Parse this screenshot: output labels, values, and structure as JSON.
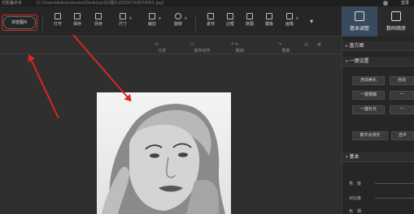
{
  "titlebar": {
    "app_title": "光影魔术手",
    "path": "[C:\\Users\\Administrator\\Desktop\\QQ图片20150730074055.jpg]",
    "login": "登录"
  },
  "toolbar": {
    "open_label": "浏览图片",
    "tools": [
      {
        "label": "打开",
        "icon": "folder-icon"
      },
      {
        "label": "保存",
        "icon": "save-icon"
      },
      {
        "label": "另存",
        "icon": "save-as-icon"
      },
      {
        "label": "尺寸",
        "icon": "resize-icon"
      },
      {
        "label": "裁剪",
        "icon": "crop-icon"
      },
      {
        "label": "旋转",
        "icon": "rotate-icon"
      },
      {
        "label": "素材",
        "icon": "material-icon"
      },
      {
        "label": "边框",
        "icon": "frame-icon"
      },
      {
        "label": "拼图",
        "icon": "collage-icon"
      },
      {
        "label": "模板",
        "icon": "template-icon"
      },
      {
        "label": "画笔",
        "icon": "brush-icon"
      }
    ]
  },
  "right_tabs": [
    {
      "label": "基本调整",
      "icon": "adjust-icon",
      "active": true
    },
    {
      "label": "数码暗房",
      "icon": "camera-icon",
      "active": false
    }
  ],
  "subbar": {
    "share": "分享",
    "save_action": "保存动作",
    "undo": "撤销",
    "redo": "重做"
  },
  "panel": {
    "histogram": "直方图",
    "one_click": "一键设置",
    "buttons": [
      "自动美化",
      "一键模糊",
      "一键补光",
      "数字点测光"
    ],
    "buttons_right": [
      "自动",
      "一",
      "一",
      "自平"
    ],
    "basic": "基本",
    "sliders": [
      "亮　度",
      "对比度",
      "色　相"
    ]
  },
  "colors": {
    "highlight": "#d03030",
    "arrow": "#d82626",
    "active_tab": "#3a4a5e"
  }
}
